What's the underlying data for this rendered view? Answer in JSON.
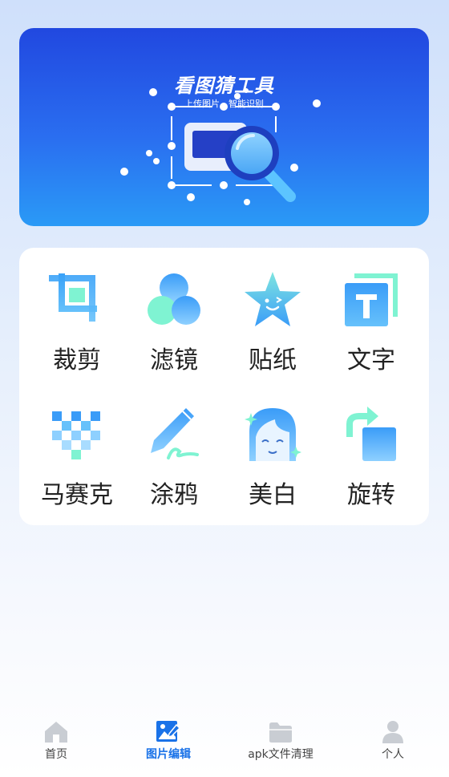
{
  "banner": {
    "title": "看图猜工具",
    "subtitle": "上传图片，智能识别"
  },
  "tools": [
    {
      "label": "裁剪",
      "icon": "crop-icon"
    },
    {
      "label": "滤镜",
      "icon": "filter-icon"
    },
    {
      "label": "贴纸",
      "icon": "sticker-icon"
    },
    {
      "label": "文字",
      "icon": "text-icon"
    },
    {
      "label": "马赛克",
      "icon": "mosaic-icon"
    },
    {
      "label": "涂鸦",
      "icon": "doodle-icon"
    },
    {
      "label": "美白",
      "icon": "whitening-icon"
    },
    {
      "label": "旋转",
      "icon": "rotate-icon"
    }
  ],
  "tabbar": {
    "items": [
      {
        "label": "首页",
        "icon": "home-icon",
        "active": false
      },
      {
        "label": "图片编辑",
        "icon": "image-edit-icon",
        "active": true
      },
      {
        "label": "apk文件清理",
        "icon": "folder-icon",
        "active": false
      },
      {
        "label": "个人",
        "icon": "user-icon",
        "active": false
      }
    ]
  },
  "colors": {
    "accent": "#1a72e8",
    "banner_top": "#2148e0",
    "banner_bottom": "#2a9af6",
    "icon_mint": "#7ff3d2",
    "icon_blue": "#3a9cf8",
    "tab_inactive": "#c9cdd3"
  }
}
